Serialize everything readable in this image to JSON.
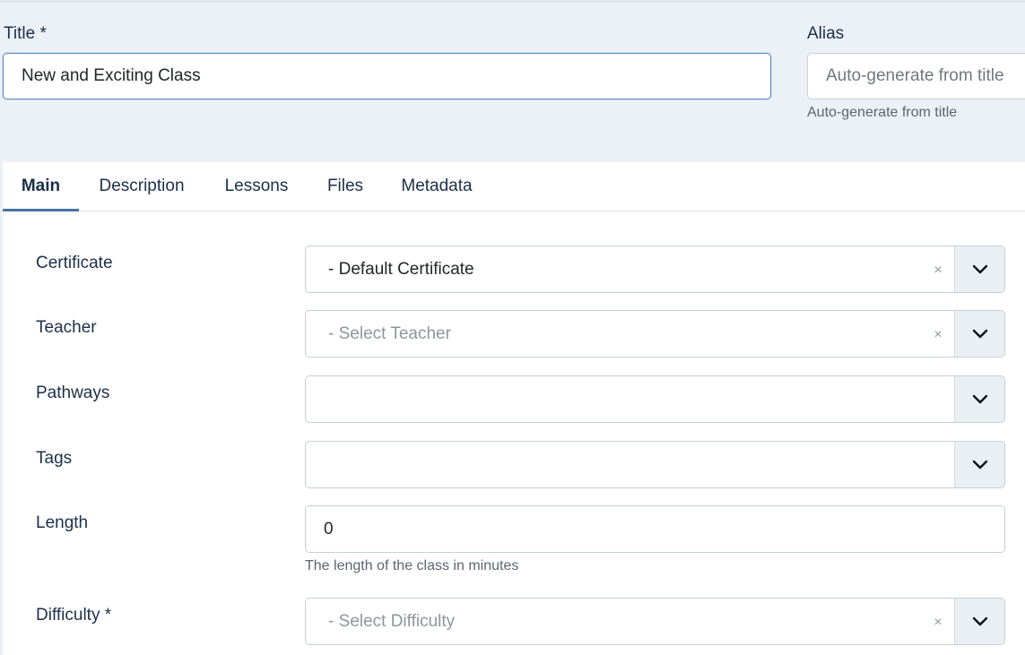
{
  "title_field": {
    "label": "Title *",
    "value": "New and Exciting Class"
  },
  "alias_field": {
    "label": "Alias",
    "placeholder": "Auto-generate from title",
    "help": "Auto-generate from title"
  },
  "tabs": [
    {
      "label": "Main",
      "active": true
    },
    {
      "label": "Description"
    },
    {
      "label": "Lessons"
    },
    {
      "label": "Files"
    },
    {
      "label": "Metadata"
    }
  ],
  "fields": {
    "certificate": {
      "label": "Certificate",
      "value": "- Default Certificate",
      "clear": "×"
    },
    "teacher": {
      "label": "Teacher",
      "placeholder": "- Select Teacher",
      "clear": "×"
    },
    "pathways": {
      "label": "Pathways"
    },
    "tags": {
      "label": "Tags"
    },
    "length": {
      "label": "Length",
      "value": "0",
      "help": "The length of the class in minutes"
    },
    "difficulty": {
      "label": "Difficulty *",
      "placeholder": "- Select Difficulty",
      "clear": "×"
    }
  },
  "icons": {
    "dropdown": "chevron-down-icon",
    "clear": "clear-icon"
  },
  "colors": {
    "accent": "#4a72a4",
    "background": "#ecf1f7",
    "text": "#1c2f4a"
  }
}
